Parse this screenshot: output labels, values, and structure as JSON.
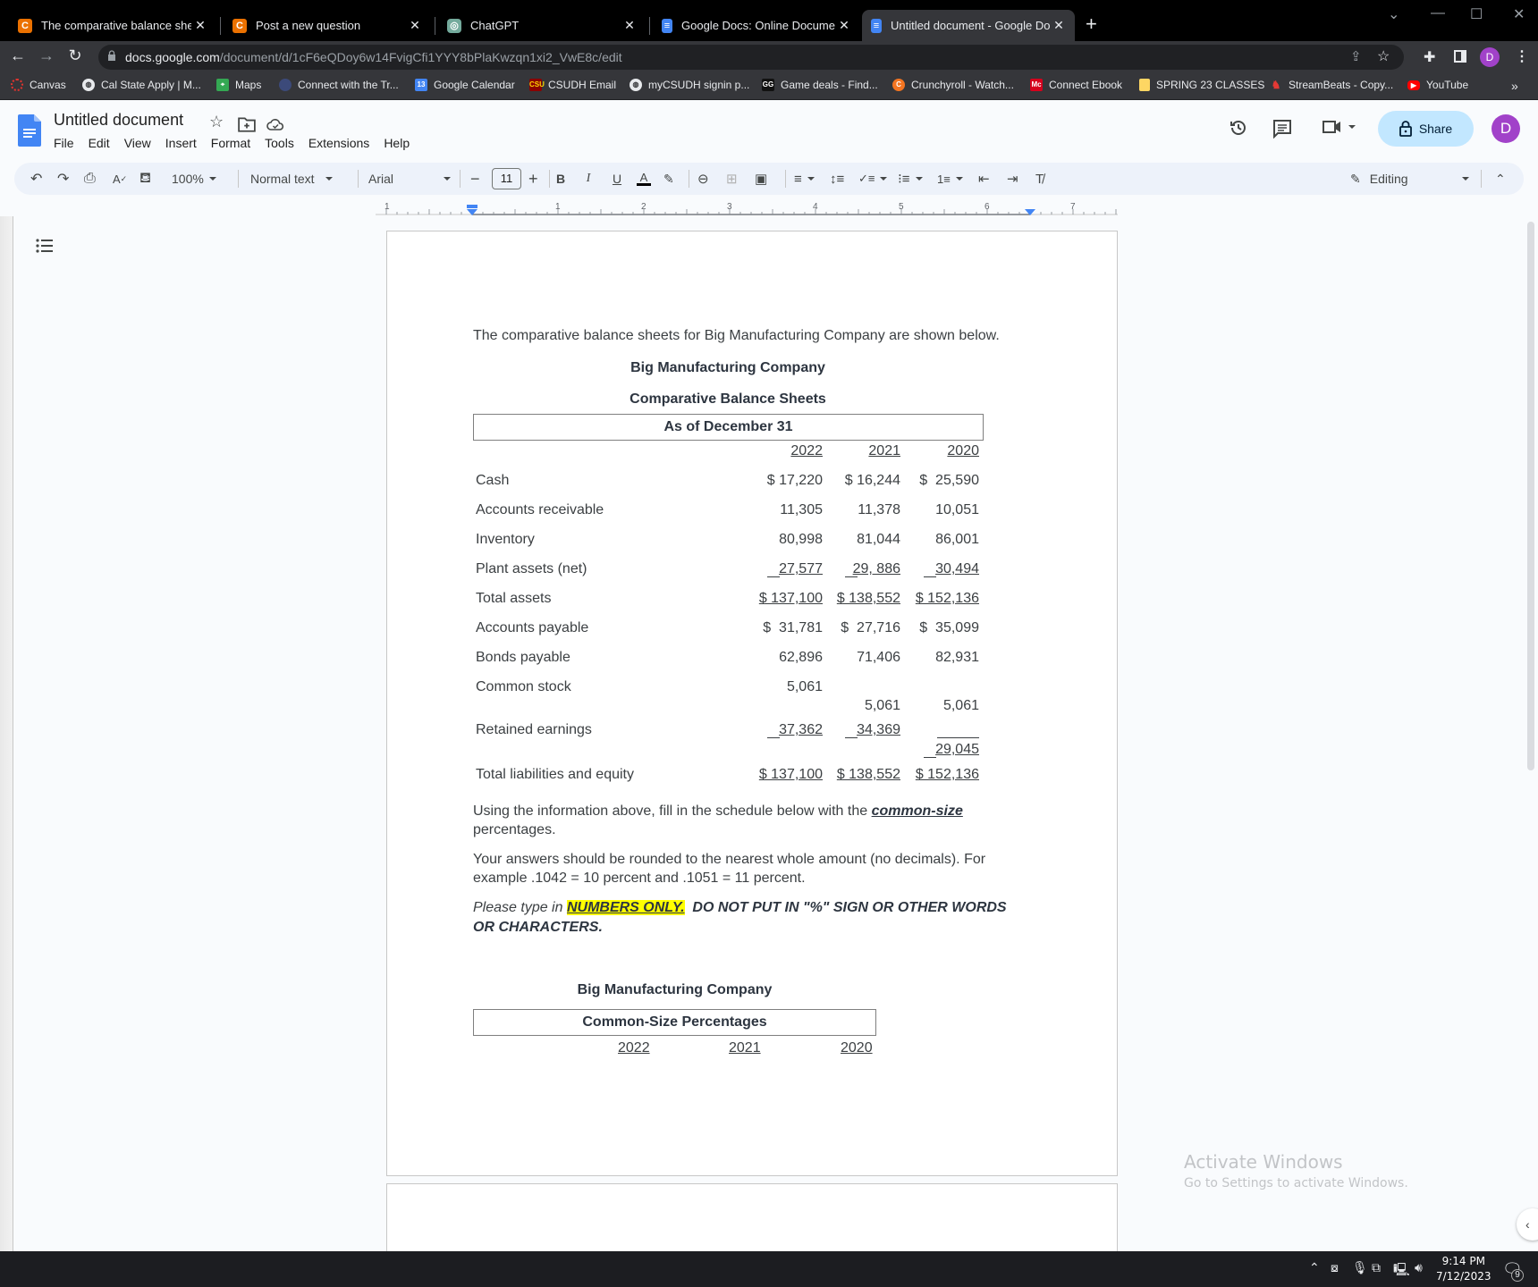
{
  "browser": {
    "tabs": [
      {
        "title": "The comparative balance sheets f",
        "icon": "chegg-icon",
        "active": false
      },
      {
        "title": "Post a new question",
        "icon": "chegg-icon",
        "active": false
      },
      {
        "title": "ChatGPT",
        "icon": "chatgpt-icon",
        "active": false
      },
      {
        "title": "Google Docs: Online Document E",
        "icon": "google-docs-icon",
        "active": false
      },
      {
        "title": "Untitled document - Google Doc",
        "icon": "google-docs-icon",
        "active": true
      }
    ],
    "new_tab": "+",
    "url_domain": "docs.google.com",
    "url_path": "/document/d/1cF6eQDoy6w14FvigCfi1YYY8bPlaKwzqn1xi2_VwE8c/edit",
    "profile_initial": "D",
    "bookmarks": [
      {
        "label": "Canvas",
        "icon": "canvas-icon"
      },
      {
        "label": "Cal State Apply | M...",
        "icon": "globe-icon"
      },
      {
        "label": "Maps",
        "icon": "maps-icon"
      },
      {
        "label": "Connect with the Tr...",
        "icon": "seal-icon"
      },
      {
        "label": "Google Calendar",
        "icon": "calendar-icon"
      },
      {
        "label": "CSUDH Email",
        "icon": "csudh-icon"
      },
      {
        "label": "myCSUDH signin p...",
        "icon": "globe-icon"
      },
      {
        "label": "Game deals - Find...",
        "icon": "gg-icon"
      },
      {
        "label": "Crunchyroll - Watch...",
        "icon": "crunchyroll-icon"
      },
      {
        "label": "Connect Ebook",
        "icon": "mcgraw-icon"
      },
      {
        "label": "SPRING 23 CLASSES",
        "icon": "folder-icon"
      },
      {
        "label": "StreamBeats - Copy...",
        "icon": "streambeats-icon"
      },
      {
        "label": "YouTube",
        "icon": "youtube-icon"
      }
    ],
    "more_bookmarks": "»"
  },
  "docs": {
    "title": "Untitled document",
    "menu": [
      "File",
      "Edit",
      "View",
      "Insert",
      "Format",
      "Tools",
      "Extensions",
      "Help"
    ],
    "share_label": "Share",
    "avatar_initial": "D",
    "toolbar": {
      "zoom": "100%",
      "style": "Normal text",
      "font": "Arial",
      "font_size": "11",
      "mode": "Editing"
    },
    "ruler_labels": [
      "1",
      "1",
      "2",
      "3",
      "4",
      "5",
      "6",
      "7"
    ]
  },
  "document": {
    "intro": "The comparative balance sheets for Big Manufacturing Company are shown below.",
    "company": "Big Manufacturing Company",
    "statement_title": "Comparative Balance Sheets",
    "date_header": "As of December 31",
    "years": [
      "2022",
      "2021",
      "2020"
    ],
    "rows": [
      {
        "label": "Cash",
        "values": [
          "$ 17,220",
          "$ 16,244",
          "$  25,590"
        ]
      },
      {
        "label": "Accounts receivable",
        "values": [
          "11,305",
          "11,378",
          "10,051"
        ]
      },
      {
        "label": "Inventory",
        "values": [
          "80,998",
          "81,044",
          "86,001"
        ]
      },
      {
        "label": "Plant assets (net)",
        "values": [
          "27,577",
          "29, 886",
          "30,494"
        ]
      },
      {
        "label": "Total assets",
        "values": [
          "$ 137,100",
          "$ 138,552",
          "$ 152,136"
        ]
      },
      {
        "label": "Accounts payable",
        "values": [
          "$  31,781",
          "$  27,716",
          "$  35,099"
        ]
      },
      {
        "label": "Bonds payable",
        "values": [
          "62,896",
          "71,406",
          "82,931"
        ]
      },
      {
        "label": "Common stock",
        "values": [
          "5,061",
          "5,061",
          "5,061"
        ]
      },
      {
        "label": "Retained earnings",
        "values": [
          "37,362",
          "34,369",
          "29,045"
        ]
      },
      {
        "label": "Total liabilities and equity",
        "values": [
          "$ 137,100",
          "$ 138,552",
          "$ 152,136"
        ]
      }
    ],
    "instruction1_pre": "Using the information above, fill in the schedule below with the ",
    "instruction1_emph": "common-size",
    "instruction1_post": "percentages.",
    "instruction2_line1": "Your answers should be rounded to the nearest whole amount (no decimals).  For",
    "instruction2_line2": "example .1042 = 10 percent and .1051 = 11 percent.",
    "instruction3_pre": "Please type in ",
    "instruction3_highlight": "NUMBERS ONLY.",
    "instruction3_post": "  DO NOT PUT IN \"%\" SIGN OR OTHER WORDS",
    "instruction3_line2": "OR CHARACTERS.",
    "schedule_company": "Big Manufacturing Company",
    "schedule_title": "Common-Size Percentages",
    "schedule_years": [
      "2022",
      "2021",
      "2020"
    ]
  },
  "windows": {
    "activate_title": "Activate Windows",
    "activate_sub": "Go to Settings to activate Windows.",
    "time": "9:14 PM",
    "date": "7/12/2023",
    "notifications": "9"
  }
}
